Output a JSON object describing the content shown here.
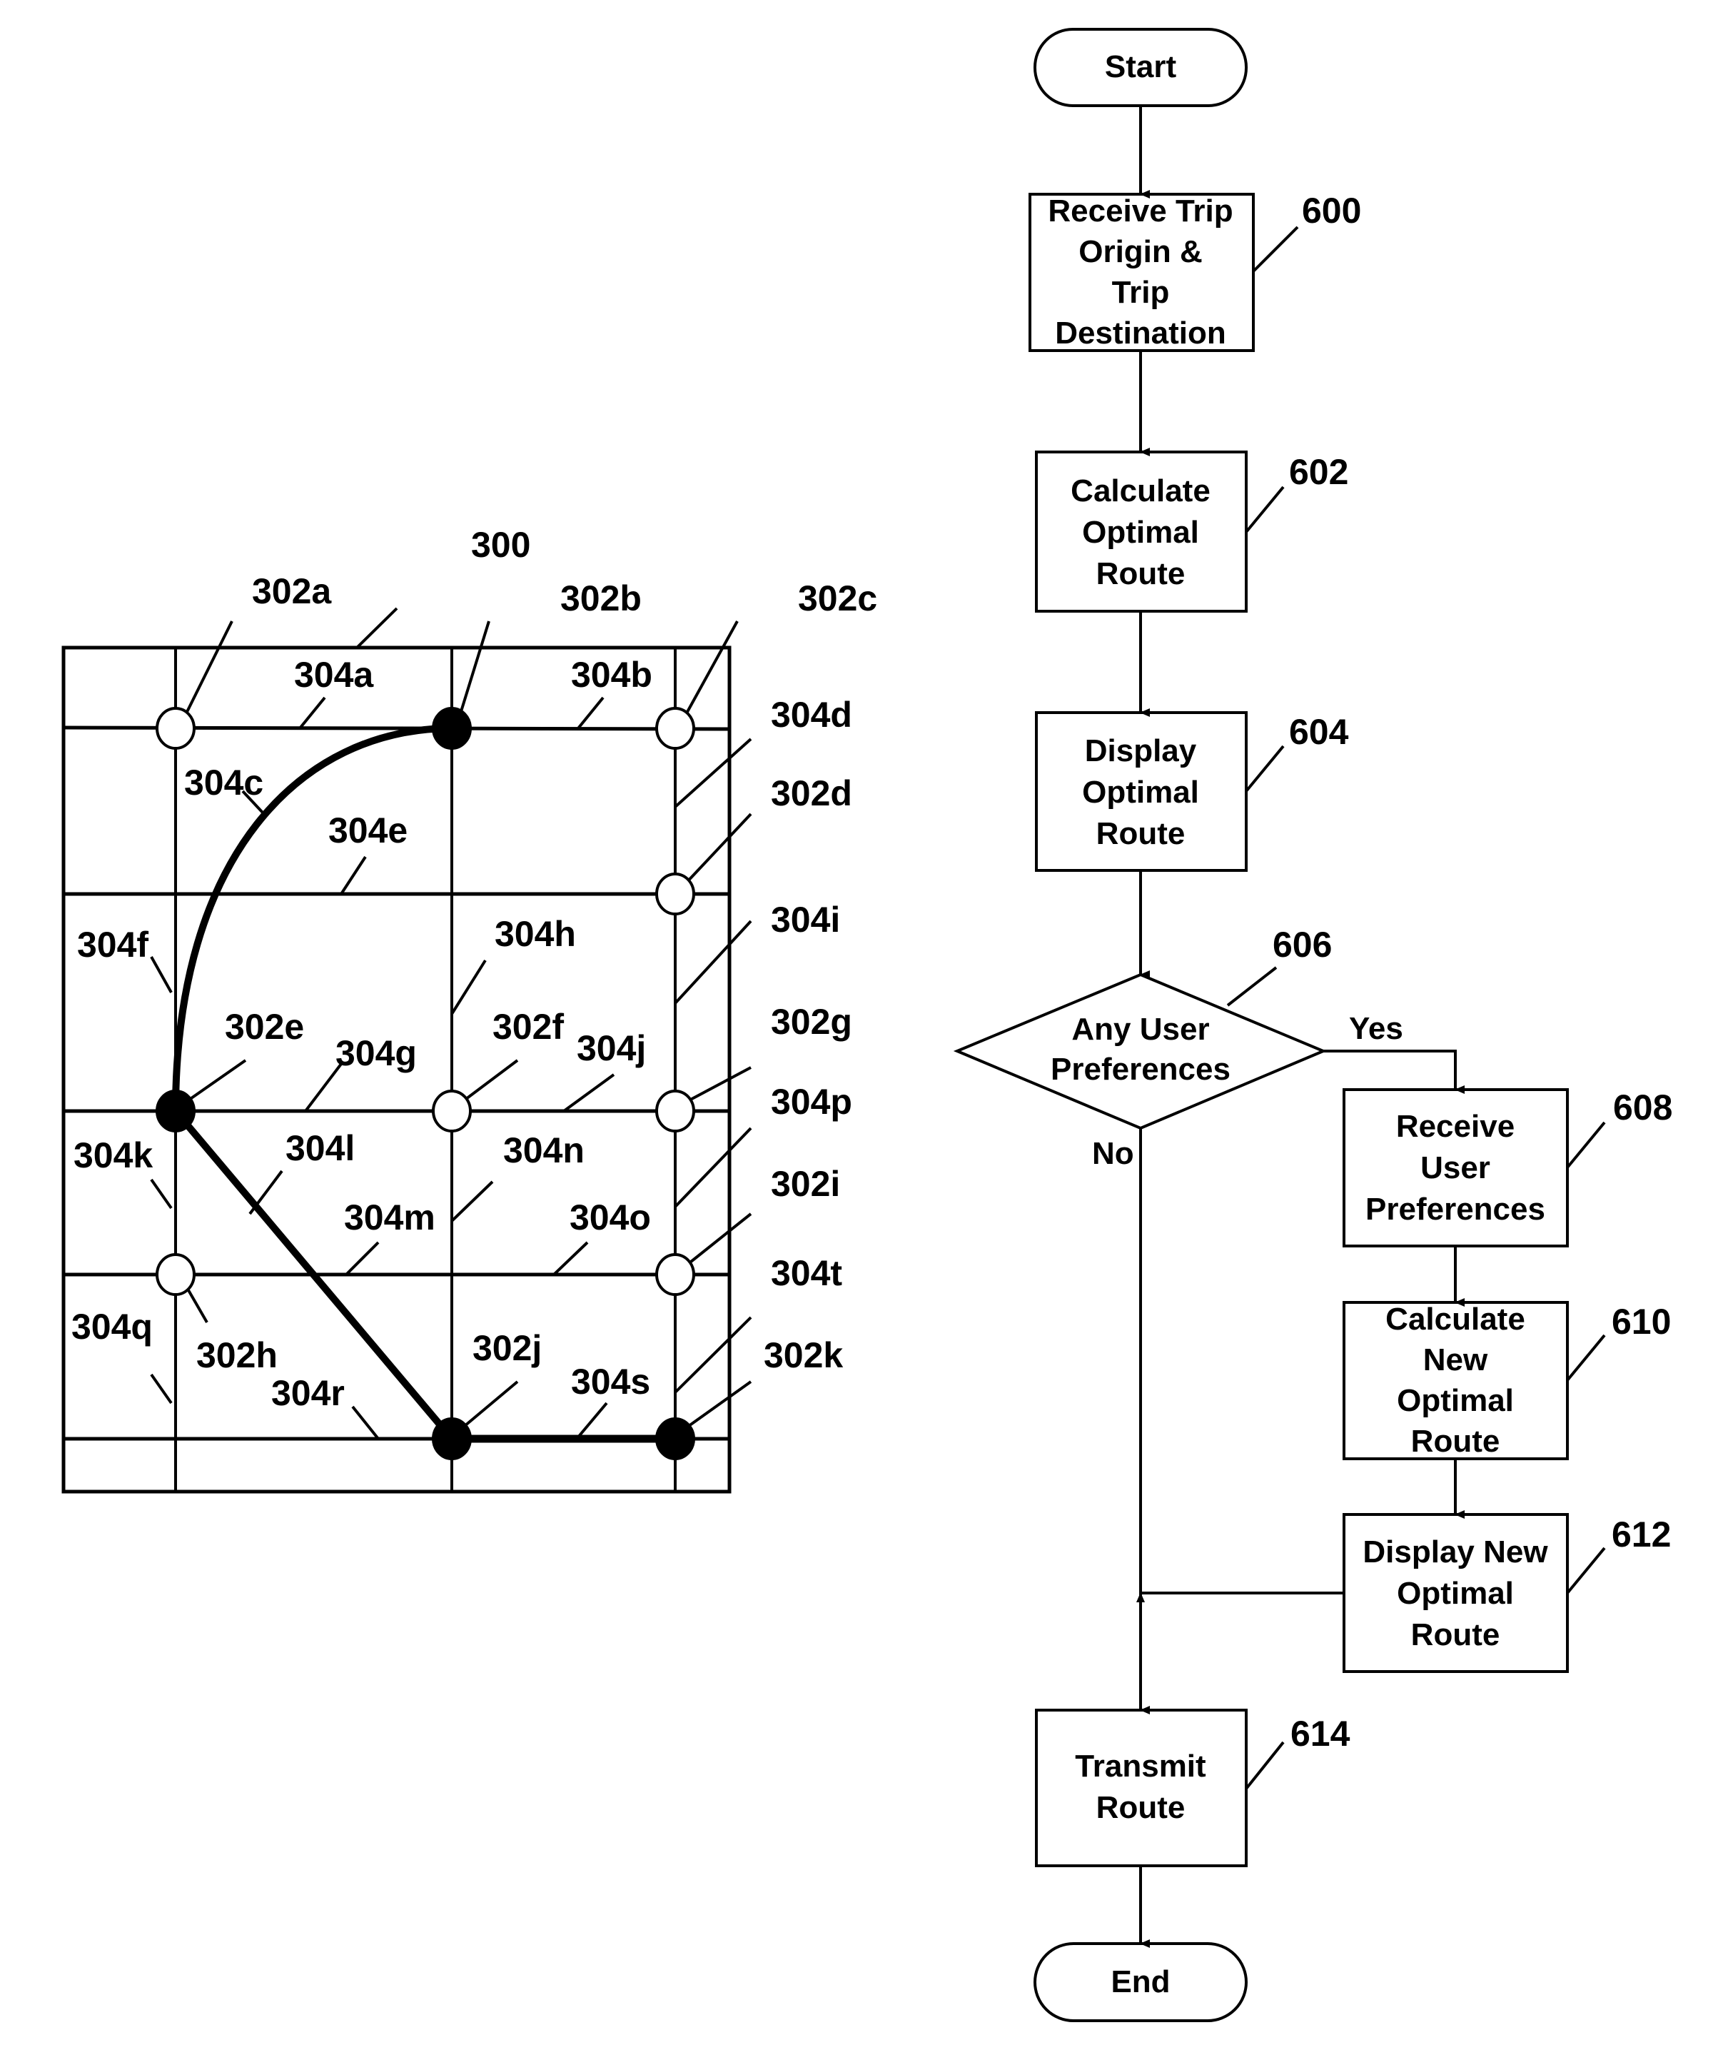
{
  "map": {
    "figure_label": "300",
    "nodes": [
      {
        "id": "302a",
        "filled": false,
        "col": 1,
        "row": 1
      },
      {
        "id": "302b",
        "filled": true,
        "col": 2,
        "row": 1
      },
      {
        "id": "302c",
        "filled": false,
        "col": 3,
        "row": 1
      },
      {
        "id": "302d",
        "filled": false,
        "col": 3,
        "row": 2
      },
      {
        "id": "302e",
        "filled": true,
        "col": 1,
        "row": 3
      },
      {
        "id": "302f",
        "filled": false,
        "col": 2,
        "row": 3
      },
      {
        "id": "302g",
        "filled": false,
        "col": 3,
        "row": 3
      },
      {
        "id": "302h",
        "filled": false,
        "col": 1,
        "row": 4
      },
      {
        "id": "302i",
        "filled": false,
        "col": 3,
        "row": 4
      },
      {
        "id": "302j",
        "filled": true,
        "col": 2,
        "row": 5
      },
      {
        "id": "302k",
        "filled": true,
        "col": 3,
        "row": 5
      }
    ],
    "segment_labels": [
      "304a",
      "304b",
      "304c",
      "304d",
      "304e",
      "304f",
      "304g",
      "304h",
      "304i",
      "304j",
      "304k",
      "304l",
      "304m",
      "304n",
      "304o",
      "304p",
      "304q",
      "304r",
      "304s",
      "304t"
    ],
    "route": [
      "302b",
      "302e",
      "302j",
      "302k"
    ]
  },
  "flowchart": {
    "start": "Start",
    "end": "End",
    "steps": [
      {
        "ref": "600",
        "lines": [
          "Receive Trip",
          "Origin &",
          "Trip",
          "Destination"
        ]
      },
      {
        "ref": "602",
        "lines": [
          "Calculate",
          "Optimal",
          "Route"
        ]
      },
      {
        "ref": "604",
        "lines": [
          "Display",
          "Optimal",
          "Route"
        ]
      },
      {
        "ref": "606",
        "lines": [
          "Any User",
          "Preferences"
        ],
        "type": "decision"
      },
      {
        "ref": "608",
        "lines": [
          "Receive",
          "User",
          "Preferences"
        ]
      },
      {
        "ref": "610",
        "lines": [
          "Calculate",
          "New",
          "Optimal",
          "Route"
        ]
      },
      {
        "ref": "612",
        "lines": [
          "Display New",
          "Optimal",
          "Route"
        ]
      },
      {
        "ref": "614",
        "lines": [
          "Transmit",
          "Route"
        ]
      }
    ],
    "yes_label": "Yes",
    "no_label": "No"
  }
}
